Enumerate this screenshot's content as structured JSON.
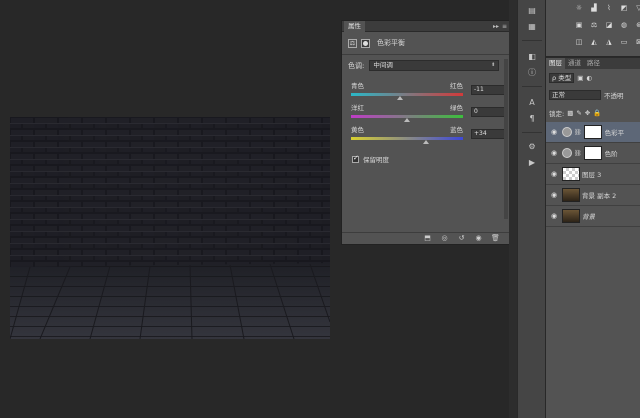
{
  "properties_panel": {
    "tab_title": "属性",
    "collapse_glyph": "▸▸",
    "menu_glyph": "≡",
    "header_label": "色彩平衡",
    "tone_label": "色调:",
    "tone_value": "中间调",
    "sliders": [
      {
        "left": "青色",
        "right": "红色",
        "value": "-11",
        "fraction": 0.44,
        "gradient": [
          "#2ab8c8",
          "#d23a3a"
        ]
      },
      {
        "left": "洋红",
        "right": "绿色",
        "value": "0",
        "fraction": 0.5,
        "gradient": [
          "#c03cc8",
          "#3cbf3c"
        ]
      },
      {
        "left": "黄色",
        "right": "蓝色",
        "value": "+34",
        "fraction": 0.67,
        "gradient": [
          "#d8d030",
          "#3e48d8"
        ]
      }
    ],
    "preserve_luminosity_label": "保留明度",
    "preserve_luminosity_checked": true
  },
  "layers_panel": {
    "tabs": [
      "图层",
      "通道",
      "路径"
    ],
    "kind_label": "ρ 类型",
    "blend_mode": "正常",
    "opacity_label": "不透明",
    "lock_label": "锁定:",
    "layers": [
      {
        "name": "色彩平",
        "type": "adjustment",
        "selected": true
      },
      {
        "name": "色阶",
        "type": "adjustment",
        "selected": false
      },
      {
        "name": "图层 3",
        "type": "transparent",
        "selected": false
      },
      {
        "name": "背景 副本 2",
        "type": "image",
        "selected": false
      },
      {
        "name": "背景",
        "type": "image",
        "selected": false,
        "italic": true
      }
    ]
  },
  "colors": {
    "workspace_bg": "#282828",
    "panel_bg": "#535353",
    "selected_layer": "#5d6777"
  }
}
